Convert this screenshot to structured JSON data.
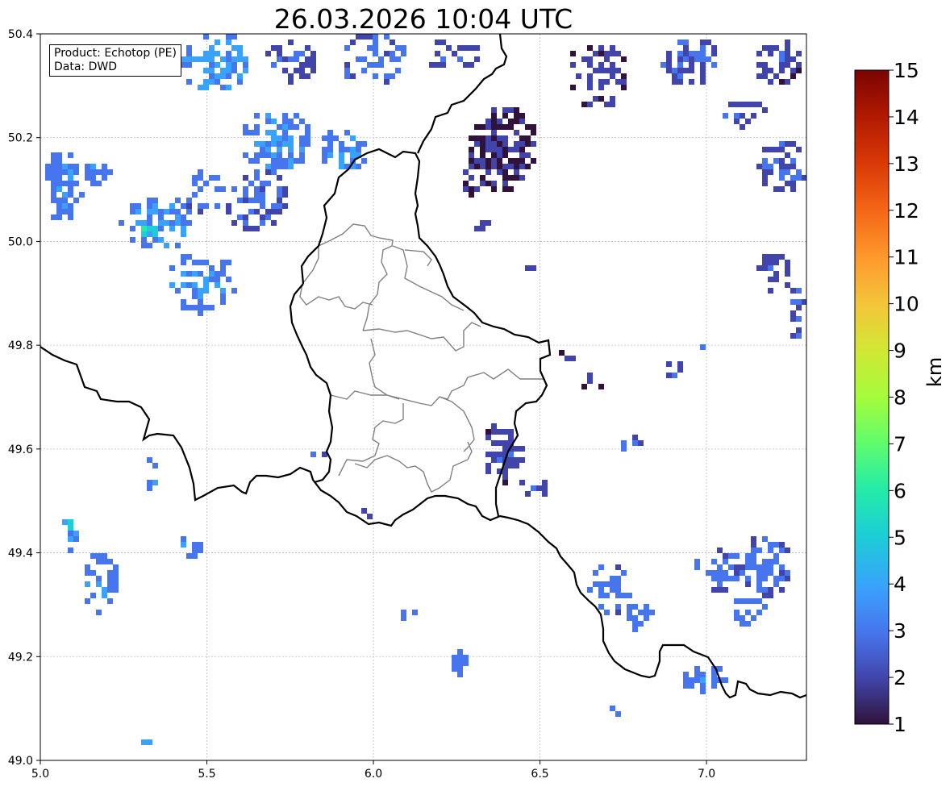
{
  "title": "26.03.2026 10:04 UTC",
  "info": {
    "product_line": "Product: Echotop (PE)",
    "data_line": "Data: DWD"
  },
  "colorbar": {
    "label": "km",
    "min": 1,
    "max": 15,
    "ticks": [
      "1",
      "2",
      "3",
      "4",
      "5",
      "6",
      "7",
      "8",
      "9",
      "10",
      "11",
      "12",
      "13",
      "14",
      "15"
    ],
    "colors": [
      "#30123b",
      "#4145ab",
      "#4675ed",
      "#39a2fc",
      "#1bcfd4",
      "#24eca6",
      "#61fc6c",
      "#a4fc3b",
      "#d1e834",
      "#f3c63a",
      "#fe9b2d",
      "#f36315",
      "#d93806",
      "#b11901",
      "#7a0402"
    ]
  },
  "axes": {
    "lon_range": [
      5.0,
      7.3
    ],
    "lat_range": [
      49.0,
      50.4
    ],
    "x_ticks": [
      "5.0",
      "5.5",
      "6.0",
      "6.5",
      "7.0"
    ],
    "y_ticks": [
      "49.0",
      "49.2",
      "49.4",
      "49.6",
      "49.8",
      "50.0",
      "50.2",
      "50.4"
    ],
    "grid": true
  }
}
